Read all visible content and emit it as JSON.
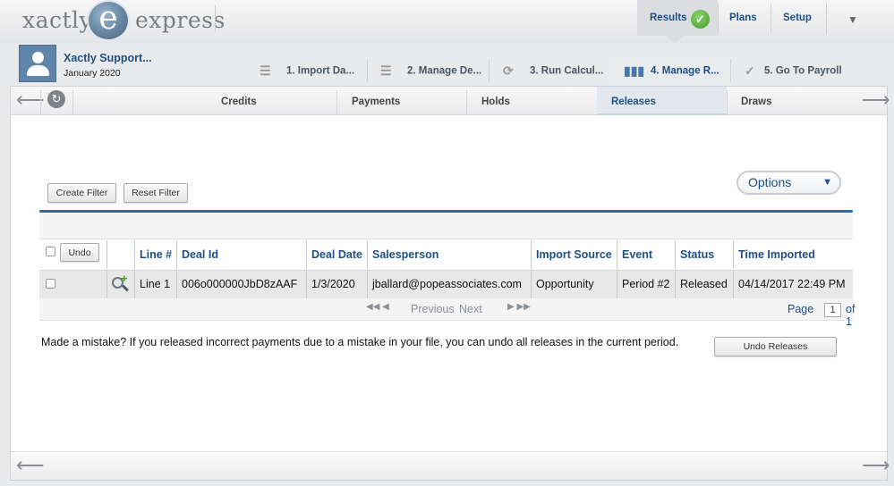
{
  "header": {
    "logo_left": "xactly",
    "logo_letter": "e",
    "logo_right": "express",
    "nav": {
      "results": "Results",
      "plans": "Plans",
      "setup": "Setup"
    }
  },
  "user": {
    "name": "Xactly Support...",
    "period": "January 2020"
  },
  "wizard": {
    "steps": [
      {
        "label": "1. Import Da...",
        "icon": "list-icon"
      },
      {
        "label": "2. Manage De...",
        "icon": "list-icon"
      },
      {
        "label": "3. Run Calcul...",
        "icon": "sync-icon"
      },
      {
        "label": "4. Manage R...",
        "icon": "bar-chart-icon"
      },
      {
        "label": "5. Go To Payroll",
        "icon": "checkmark-icon"
      }
    ],
    "active_index": 3
  },
  "subtabs": [
    "Credits",
    "Payments",
    "Holds",
    "Releases",
    "Draws"
  ],
  "active_subtab": "Releases",
  "toolbar": {
    "create_filter": "Create Filter",
    "reset_filter": "Reset Filter",
    "options": "Options"
  },
  "table": {
    "undo_label": "Undo",
    "columns": [
      "Line #",
      "Deal Id",
      "Deal Date",
      "Salesperson",
      "Import Source",
      "Event",
      "Status",
      "Time Imported"
    ],
    "rows": [
      [
        "Line 1",
        "006o000000JbD8zAAF",
        "1/3/2020",
        "jballard@popeassociates.com",
        "Opportunity",
        "Period #2",
        "Released",
        "04/14/2017 22:49 PM"
      ]
    ]
  },
  "pager": {
    "previous": "Previous",
    "next": "Next",
    "page_label": "Page",
    "page_value": "1",
    "of_label": "of 1"
  },
  "footer_note": {
    "text": "Made a mistake? If you released incorrect payments due to a mistake in your file, you can undo all releases in the current period.",
    "undo_releases": "Undo Releases"
  },
  "colors": {
    "accent": "#1d4f87",
    "rule": "#2b6aa6",
    "success": "#3d9c28"
  }
}
